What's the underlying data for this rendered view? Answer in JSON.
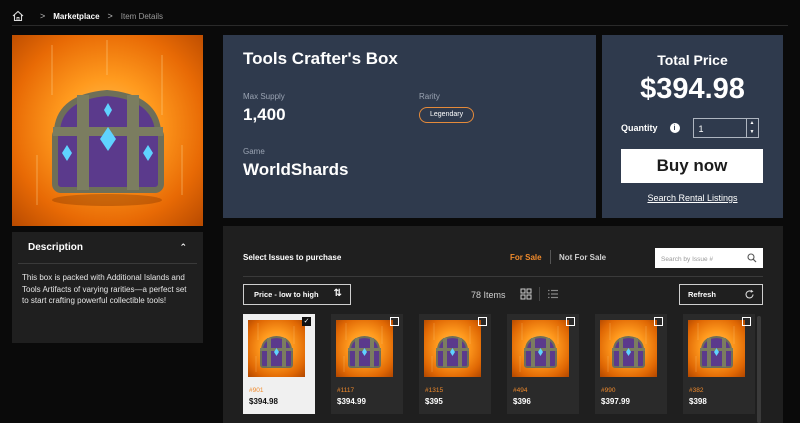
{
  "breadcrumb": {
    "items": [
      "Marketplace",
      "Item Details"
    ]
  },
  "item": {
    "title": "Tools Crafter's Box",
    "max_supply_label": "Max Supply",
    "max_supply": "1,400",
    "rarity_label": "Rarity",
    "rarity": "Legendary",
    "game_label": "Game",
    "game": "WorldShards"
  },
  "description": {
    "heading": "Description",
    "text": "This box is packed with Additional Islands and Tools Artifacts of varying rarities—a perfect set to start crafting powerful collectible tools!"
  },
  "purchase": {
    "total_label": "Total Price",
    "total": "$394.98",
    "quantity_label": "Quantity",
    "quantity": "1",
    "buy_label": "Buy now",
    "rental_link": "Search Rental Listings"
  },
  "issues": {
    "title": "Select Issues to purchase",
    "tab_for_sale": "For Sale",
    "tab_not_for_sale": "Not For Sale",
    "search_placeholder": "Search by Issue #",
    "sort_label": "Price - low to high",
    "count": "78 Items",
    "refresh_label": "Refresh",
    "cards": [
      {
        "issue": "#901",
        "price": "$394.98",
        "selected": true
      },
      {
        "issue": "#1117",
        "price": "$394.99",
        "selected": false
      },
      {
        "issue": "#1315",
        "price": "$395",
        "selected": false
      },
      {
        "issue": "#494",
        "price": "$396",
        "selected": false
      },
      {
        "issue": "#990",
        "price": "$397.99",
        "selected": false
      },
      {
        "issue": "#382",
        "price": "$398",
        "selected": false
      }
    ]
  },
  "colors": {
    "accent": "#f08a2b",
    "panel": "#2f3a4d",
    "dark_panel": "#1f1f1f",
    "background": "#0a0a0a"
  },
  "icons": {
    "home": "home-icon",
    "chevron": "chevron-right-icon",
    "collapse": "chevron-up-icon",
    "info": "info-icon",
    "search": "search-icon",
    "sort": "sort-arrows-icon",
    "grid": "grid-view-icon",
    "list": "list-view-icon",
    "refresh": "refresh-icon",
    "check": "check-icon"
  }
}
